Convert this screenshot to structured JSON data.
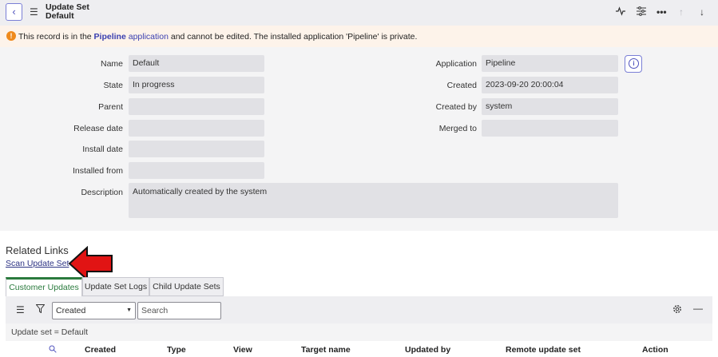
{
  "header": {
    "title": "Update Set",
    "subtitle": "Default",
    "back_icon": "chevron-left-icon",
    "menu_icon": "hamburger-icon",
    "actions": [
      "activity-icon",
      "settings-sliders-icon",
      "more-icon",
      "arrow-up-icon",
      "arrow-down-icon"
    ]
  },
  "alert": {
    "icon": "!",
    "text_before": "This record is in the ",
    "app_name": "Pipeline",
    "app_word": " application",
    "text_after": " and cannot be edited. The installed application 'Pipeline' is private."
  },
  "form": {
    "name_label": "Name",
    "name_value": "Default",
    "state_label": "State",
    "state_value": "In progress",
    "parent_label": "Parent",
    "parent_value": "",
    "release_date_label": "Release date",
    "release_date_value": "",
    "install_date_label": "Install date",
    "install_date_value": "",
    "installed_from_label": "Installed from",
    "installed_from_value": "",
    "description_label": "Description",
    "description_value": "Automatically created by the system",
    "application_label": "Application",
    "application_value": "Pipeline",
    "created_label": "Created",
    "created_value": "2023-09-20 20:00:04",
    "created_by_label": "Created by",
    "created_by_value": "system",
    "merged_to_label": "Merged to",
    "merged_to_value": "",
    "info_icon": "i"
  },
  "related_links": {
    "title": "Related Links",
    "scan_label": "Scan Update Set"
  },
  "tabs": [
    {
      "label": "Customer Updates"
    },
    {
      "label": "Update Set Logs"
    },
    {
      "label": "Child Update Sets"
    }
  ],
  "list": {
    "select_value": "Created",
    "search_placeholder": "Search",
    "filter_text": "Update set = Default",
    "columns": [
      "Created",
      "Type",
      "View",
      "Target name",
      "Updated by",
      "Remote update set",
      "Action"
    ]
  },
  "colors": {
    "accent": "#4f52bd",
    "tab_active": "#2a7a3d",
    "alert_bg": "#fdf3ea",
    "alert_icon": "#ef8a1c",
    "arrow": "#e11414"
  }
}
